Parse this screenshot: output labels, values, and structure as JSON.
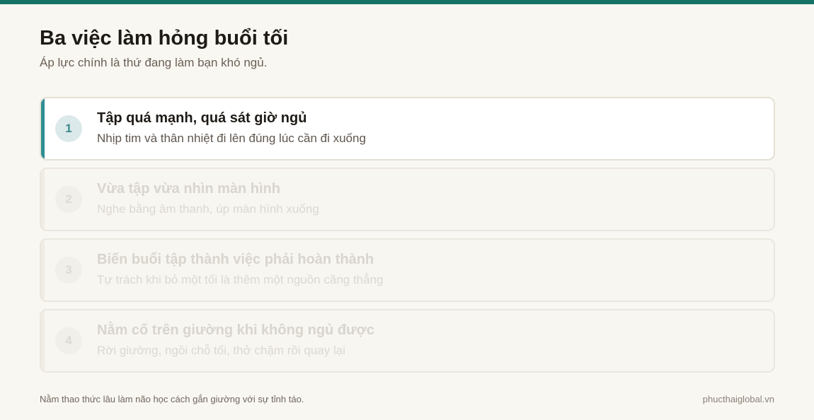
{
  "header": {
    "title": "Ba việc làm hỏng buổi tối",
    "subtitle": "Áp lực chính là thứ đang làm bạn khó ngủ."
  },
  "steps": [
    {
      "number": "1",
      "title": "Tập quá mạnh, quá sát giờ ngủ",
      "description": "Nhịp tim và thân nhiệt đi lên đúng lúc cần đi xuống",
      "state": "active"
    },
    {
      "number": "2",
      "title": "Vừa tập vừa nhìn màn hình",
      "description": "Nghe bằng âm thanh, úp màn hình xuống",
      "state": "inactive"
    },
    {
      "number": "3",
      "title": "Biến buổi tập thành việc phải hoàn thành",
      "description": "Tự trách khi bỏ một tối là thêm một nguồn căng thẳng",
      "state": "inactive"
    },
    {
      "number": "4",
      "title": "Nằm cố trên giường khi không ngủ được",
      "description": "Rời giường, ngồi chỗ tối, thở chậm rồi quay lại",
      "state": "inactive"
    }
  ],
  "footer": {
    "note": "Nằm thao thức lâu làm não học cách gắn giường với sự tỉnh táo.",
    "site": "phucthaiglobal.vn"
  },
  "colors": {
    "top_bar": "#157366",
    "accent": "#2e8f93",
    "background": "#f9f7f2"
  }
}
